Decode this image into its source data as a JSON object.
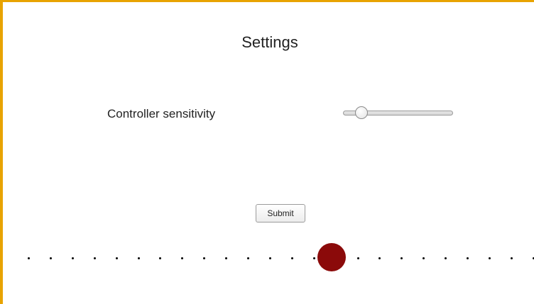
{
  "title": "Settings",
  "settings": {
    "sensitivity_label": "Controller sensitivity",
    "sensitivity_value": 0.12
  },
  "submit_label": "Submit",
  "track": {
    "dot_count": 24,
    "marker_index": 14,
    "marker_color": "#8b0a0a"
  },
  "colors": {
    "frame_border": "#e8a300"
  }
}
